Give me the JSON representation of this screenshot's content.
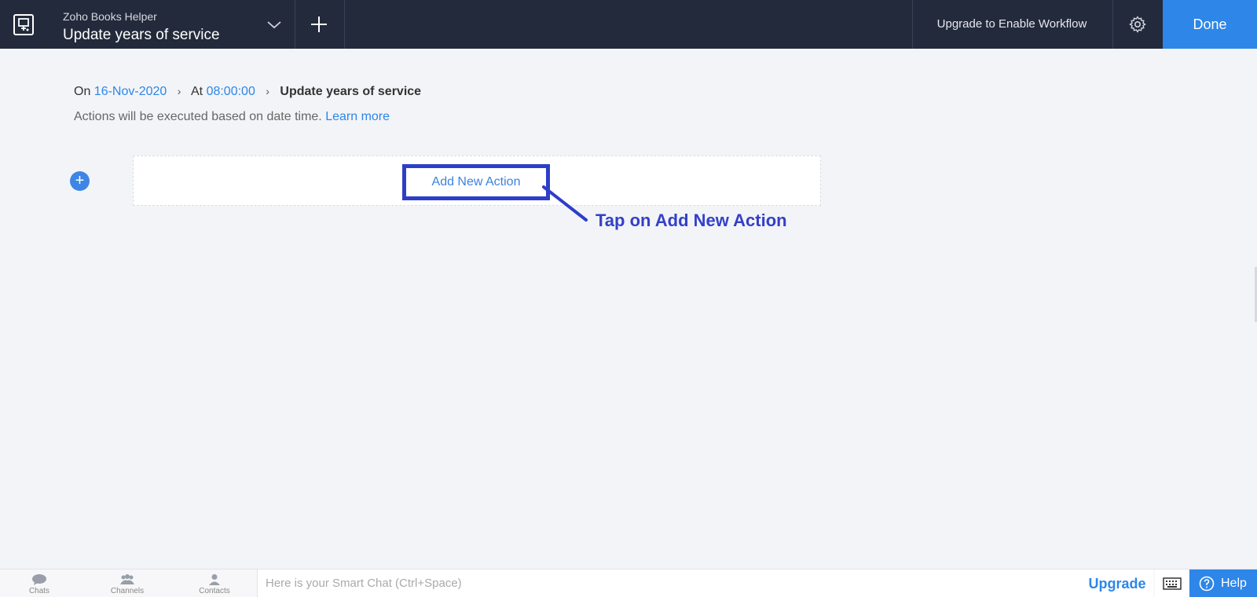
{
  "header": {
    "app_name": "Zoho Books Helper",
    "title": "Update years of service",
    "upgrade_workflow": "Upgrade to Enable Workflow",
    "done_label": "Done"
  },
  "breadcrumb": {
    "on_label": "On",
    "date": "16-Nov-2020",
    "at_label": "At",
    "time": "08:00:00",
    "current": "Update years of service"
  },
  "description": {
    "text": "Actions will be executed based on date time.",
    "learn_more": "Learn more"
  },
  "actions": {
    "add_symbol": "+",
    "add_new_action": "Add New Action"
  },
  "annotation": {
    "text": "Tap on Add New Action",
    "color": "#3340c8"
  },
  "bottom_bar": {
    "nav": [
      {
        "label": "Chats",
        "icon": "chats-icon"
      },
      {
        "label": "Channels",
        "icon": "channels-icon"
      },
      {
        "label": "Contacts",
        "icon": "contacts-icon"
      }
    ],
    "chat_placeholder": "Here is your Smart Chat (Ctrl+Space)",
    "upgrade": "Upgrade",
    "help": "Help"
  },
  "colors": {
    "topbar": "#232a3b",
    "accent": "#2d86e8",
    "background": "#f3f4f8"
  }
}
